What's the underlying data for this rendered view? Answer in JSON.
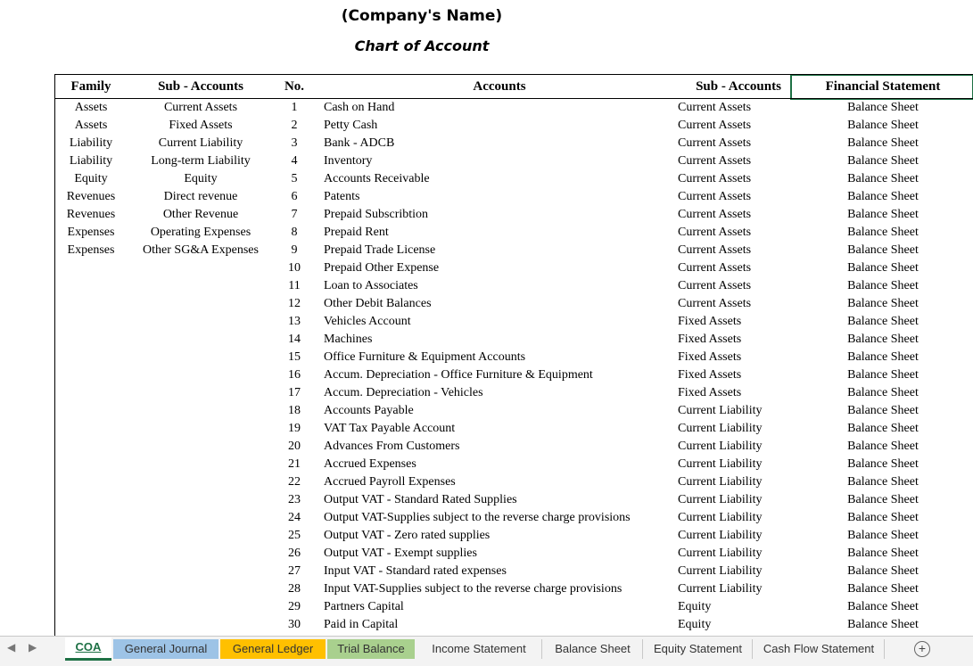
{
  "title": {
    "company": "(Company's Name)",
    "subtitle": "Chart of Account"
  },
  "headers": {
    "family": "Family",
    "sub_accounts_left": "Sub - Accounts",
    "no": "No.",
    "accounts": "Accounts",
    "sub_accounts_right": "Sub - Accounts",
    "financial_statement": "Financial Statement"
  },
  "families": [
    {
      "family": "Assets",
      "sub": "Current Assets"
    },
    {
      "family": "Assets",
      "sub": "Fixed Assets"
    },
    {
      "family": "Liability",
      "sub": "Current Liability"
    },
    {
      "family": "Liability",
      "sub": "Long-term Liability"
    },
    {
      "family": "Equity",
      "sub": "Equity"
    },
    {
      "family": "Revenues",
      "sub": "Direct revenue"
    },
    {
      "family": "Revenues",
      "sub": "Other Revenue"
    },
    {
      "family": "Expenses",
      "sub": "Operating Expenses"
    },
    {
      "family": "Expenses",
      "sub": "Other SG&A Expenses"
    }
  ],
  "accounts": [
    {
      "no": "1",
      "name": "Cash on Hand",
      "sub": "Current Assets",
      "fs": "Balance Sheet"
    },
    {
      "no": "2",
      "name": "Petty Cash",
      "sub": "Current Assets",
      "fs": "Balance Sheet"
    },
    {
      "no": "3",
      "name": "Bank - ADCB",
      "sub": "Current Assets",
      "fs": "Balance Sheet"
    },
    {
      "no": "4",
      "name": "Inventory",
      "sub": "Current Assets",
      "fs": "Balance Sheet"
    },
    {
      "no": "5",
      "name": "Accounts Receivable",
      "sub": "Current Assets",
      "fs": "Balance Sheet"
    },
    {
      "no": "6",
      "name": "Patents",
      "sub": "Current Assets",
      "fs": "Balance Sheet"
    },
    {
      "no": "7",
      "name": "Prepaid Subscribtion",
      "sub": "Current Assets",
      "fs": "Balance Sheet"
    },
    {
      "no": "8",
      "name": "Prepaid Rent",
      "sub": "Current Assets",
      "fs": "Balance Sheet"
    },
    {
      "no": "9",
      "name": "Prepaid Trade License",
      "sub": "Current Assets",
      "fs": "Balance Sheet"
    },
    {
      "no": "10",
      "name": "Prepaid Other Expense",
      "sub": "Current Assets",
      "fs": "Balance Sheet"
    },
    {
      "no": "11",
      "name": "Loan to Associates",
      "sub": "Current Assets",
      "fs": "Balance Sheet"
    },
    {
      "no": "12",
      "name": "Other Debit Balances",
      "sub": "Current Assets",
      "fs": "Balance Sheet"
    },
    {
      "no": "13",
      "name": "Vehicles Account",
      "sub": "Fixed Assets",
      "fs": "Balance Sheet"
    },
    {
      "no": "14",
      "name": "Machines",
      "sub": "Fixed Assets",
      "fs": "Balance Sheet"
    },
    {
      "no": "15",
      "name": "Office Furniture & Equipment Accounts",
      "sub": "Fixed Assets",
      "fs": "Balance Sheet"
    },
    {
      "no": "16",
      "name": "Accum. Depreciation - Office Furniture & Equipment",
      "sub": "Fixed Assets",
      "fs": "Balance Sheet"
    },
    {
      "no": "17",
      "name": "Accum. Depreciation - Vehicles",
      "sub": "Fixed Assets",
      "fs": "Balance Sheet"
    },
    {
      "no": "18",
      "name": "Accounts Payable",
      "sub": "Current Liability",
      "fs": "Balance Sheet"
    },
    {
      "no": "19",
      "name": "VAT Tax Payable Account",
      "sub": "Current Liability",
      "fs": "Balance Sheet"
    },
    {
      "no": "20",
      "name": "Advances From Customers",
      "sub": "Current Liability",
      "fs": "Balance Sheet"
    },
    {
      "no": "21",
      "name": "Accrued Expenses",
      "sub": "Current Liability",
      "fs": "Balance Sheet"
    },
    {
      "no": "22",
      "name": "Accrued Payroll Expenses",
      "sub": "Current Liability",
      "fs": "Balance Sheet"
    },
    {
      "no": "23",
      "name": "Output VAT - Standard Rated Supplies",
      "sub": "Current Liability",
      "fs": "Balance Sheet"
    },
    {
      "no": "24",
      "name": "Output VAT-Supplies subject to the reverse charge provisions",
      "sub": "Current Liability",
      "fs": "Balance Sheet"
    },
    {
      "no": "25",
      "name": "Output VAT - Zero rated supplies",
      "sub": "Current Liability",
      "fs": "Balance Sheet"
    },
    {
      "no": "26",
      "name": "Output VAT - Exempt supplies",
      "sub": "Current Liability",
      "fs": "Balance Sheet"
    },
    {
      "no": "27",
      "name": "Input VAT - Standard rated expenses",
      "sub": "Current Liability",
      "fs": "Balance Sheet"
    },
    {
      "no": "28",
      "name": "Input VAT-Supplies subject to the reverse charge provisions",
      "sub": "Current Liability",
      "fs": "Balance Sheet"
    },
    {
      "no": "29",
      "name": "Partners Capital",
      "sub": "Equity",
      "fs": "Balance Sheet"
    },
    {
      "no": "30",
      "name": "Paid in Capital",
      "sub": "Equity",
      "fs": "Balance Sheet"
    }
  ],
  "tabs": [
    {
      "label": "COA",
      "bg": "#ffffff",
      "active": true
    },
    {
      "label": "General Journal",
      "bg": "#9dc3e6",
      "active": false
    },
    {
      "label": "General Ledger",
      "bg": "#ffc000",
      "active": false
    },
    {
      "label": "Trial Balance",
      "bg": "#a9d08e",
      "active": false
    },
    {
      "label": "Income Statement",
      "bg": "",
      "active": false
    },
    {
      "label": "Balance Sheet",
      "bg": "",
      "active": false
    },
    {
      "label": "Equity Statement",
      "bg": "",
      "active": false
    },
    {
      "label": "Cash Flow Statement",
      "bg": "",
      "active": false
    }
  ],
  "tab_controls": {
    "prev": "◀",
    "next": "▶",
    "add": "+"
  },
  "colors": {
    "active_tab": "#1e7145",
    "selected_cell_border": "#1e7145"
  }
}
